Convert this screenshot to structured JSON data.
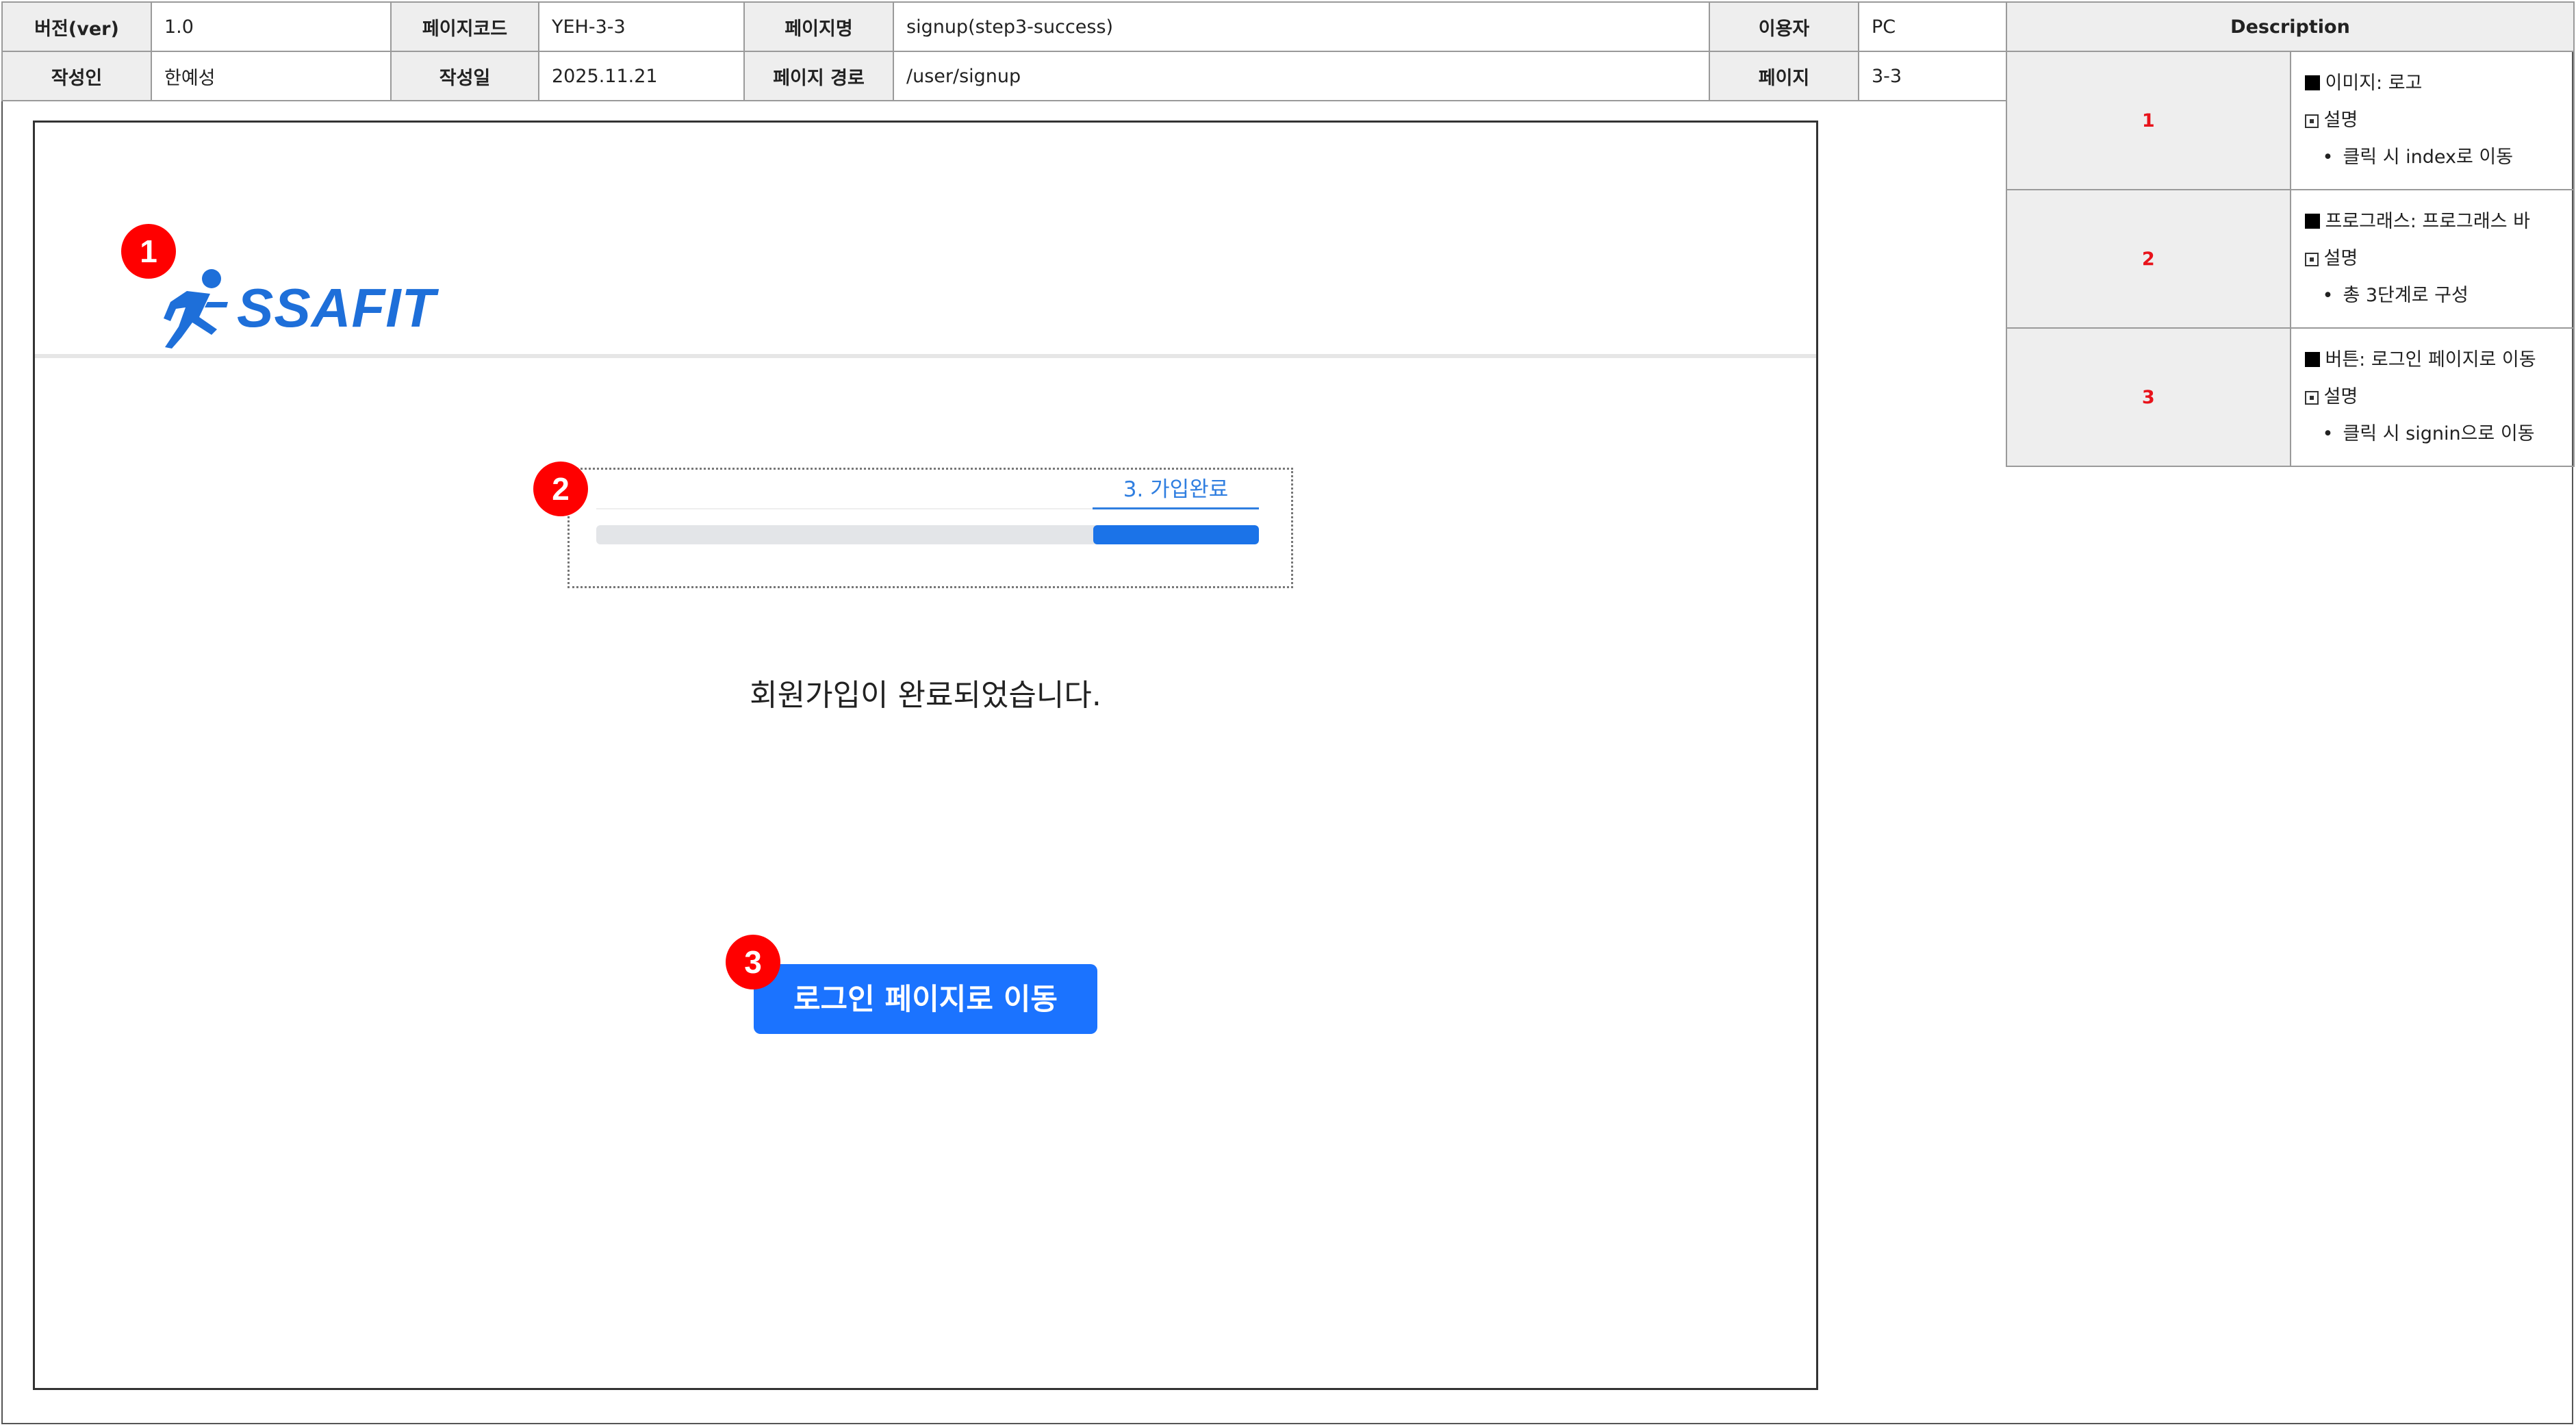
{
  "meta": {
    "version_label": "버전(ver)",
    "version": "1.0",
    "code_label": "페이지코드",
    "code": "YEH-3-3",
    "name_label": "페이지명",
    "name": "signup(step3-success)",
    "user_label": "이용자",
    "user": "PC",
    "author_label": "작성인",
    "author": "한예성",
    "date_label": "작성일",
    "date": "2025.11.21",
    "path_label": "페이지 경로",
    "path": "/user/signup",
    "page_label": "페이지",
    "page": "3-3"
  },
  "description": {
    "title": "Description",
    "items": [
      {
        "num": "1",
        "title": "이미지: 로고",
        "sub": "설명",
        "bullet": "클릭 시 index로 이동"
      },
      {
        "num": "2",
        "title": "프로그래스: 프로그래스 바",
        "sub": "설명",
        "bullet": "총 3단계로 구성"
      },
      {
        "num": "3",
        "title": "버튼: 로그인 페이지로 이동",
        "sub": "설명",
        "bullet": "클릭 시 signin으로 이동"
      }
    ]
  },
  "screen": {
    "logo_text": "SSAFIT",
    "progress": {
      "step_label": "3. 가입완료",
      "fraction": 0.25
    },
    "message": "회원가입이 완료되었습니다.",
    "button_label": "로그인 페이지로 이동",
    "markers": [
      "1",
      "2",
      "3"
    ]
  },
  "colors": {
    "accent": "#1b73ff",
    "marker": "#ff0000",
    "label_bg": "#eeeeee"
  }
}
